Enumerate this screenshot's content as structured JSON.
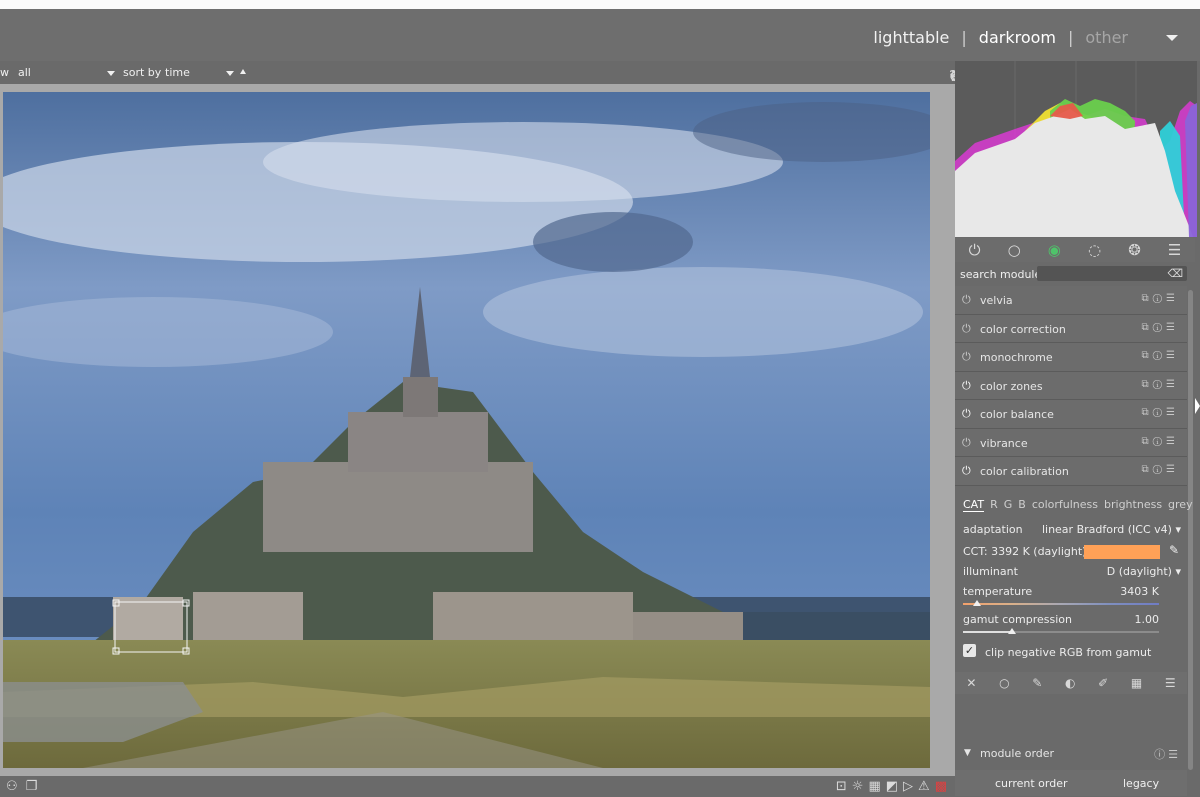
{
  "header": {
    "views": [
      {
        "label": "lighttable",
        "state": "normal"
      },
      {
        "label": "darkroom",
        "state": "active"
      },
      {
        "label": "other",
        "state": "dim"
      }
    ]
  },
  "filterbar": {
    "view_prefix": "w",
    "filter_value": "all",
    "sort_label": "sort by",
    "sort_value": "time"
  },
  "panel": {
    "search_label": "search module",
    "search_placeholder": "",
    "modules": [
      {
        "name": "velvia",
        "enabled": false
      },
      {
        "name": "color correction",
        "enabled": false
      },
      {
        "name": "monochrome",
        "enabled": false
      },
      {
        "name": "color zones",
        "enabled": true
      },
      {
        "name": "color balance",
        "enabled": true
      },
      {
        "name": "vibrance",
        "enabled": false
      },
      {
        "name": "color calibration",
        "enabled": true
      }
    ],
    "calibration": {
      "tabs": [
        "CAT",
        "R",
        "G",
        "B",
        "colorfulness",
        "brightness",
        "grey"
      ],
      "active_tab": "CAT",
      "adaptation_label": "adaptation",
      "adaptation_value": "linear Bradford (ICC v4)",
      "cct_label": "CCT: 3392 K (daylight)",
      "cct_color": "#ffa157",
      "illuminant_label": "illuminant",
      "illuminant_value": "D (daylight)",
      "temperature_label": "temperature",
      "temperature_value": "3403 K",
      "gamut_label": "gamut compression",
      "gamut_value": "1.00",
      "clip_label": "clip negative RGB from gamut",
      "clip_checked": true
    },
    "module_order_label": "module order",
    "order_current": "current order",
    "order_legacy": "legacy"
  }
}
